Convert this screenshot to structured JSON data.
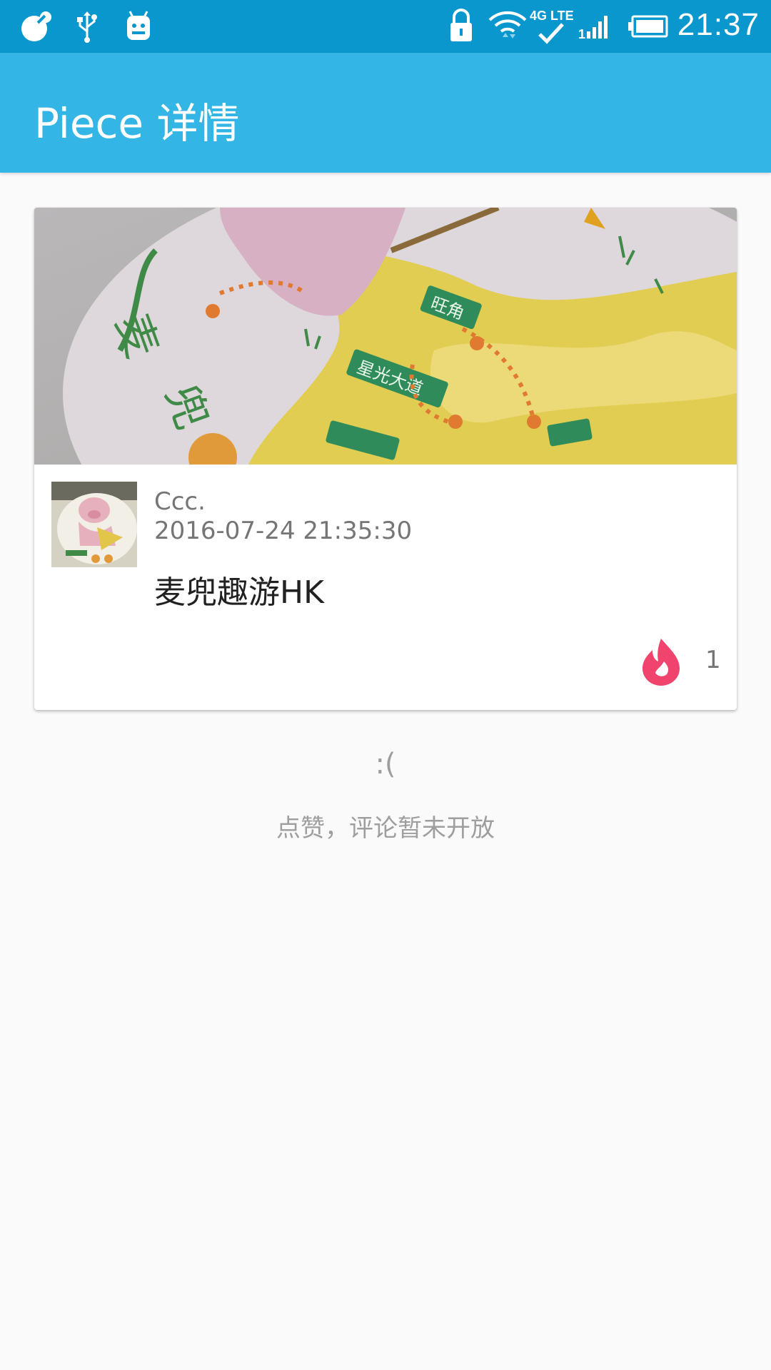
{
  "status_bar": {
    "time": "21:37",
    "network_label": "4G LTE",
    "icons": [
      "notification-icon",
      "usb-icon",
      "android-debug-icon",
      "lock-icon",
      "wifi-icon",
      "lte-signal-icon",
      "cell-signal-icon",
      "battery-icon"
    ]
  },
  "app_bar": {
    "title": "Piece 详情",
    "background_color": "#33b5e5"
  },
  "post": {
    "author": "Ccc.",
    "timestamp": "2016-07-24 21:35:30",
    "content": "麦兜趣游HK",
    "like_count": "1",
    "like_color": "#f0446e",
    "cover_labels": [
      "旺角",
      "星光大道"
    ]
  },
  "empty_state": {
    "face": ":(",
    "message": "点赞，评论暂未开放"
  }
}
